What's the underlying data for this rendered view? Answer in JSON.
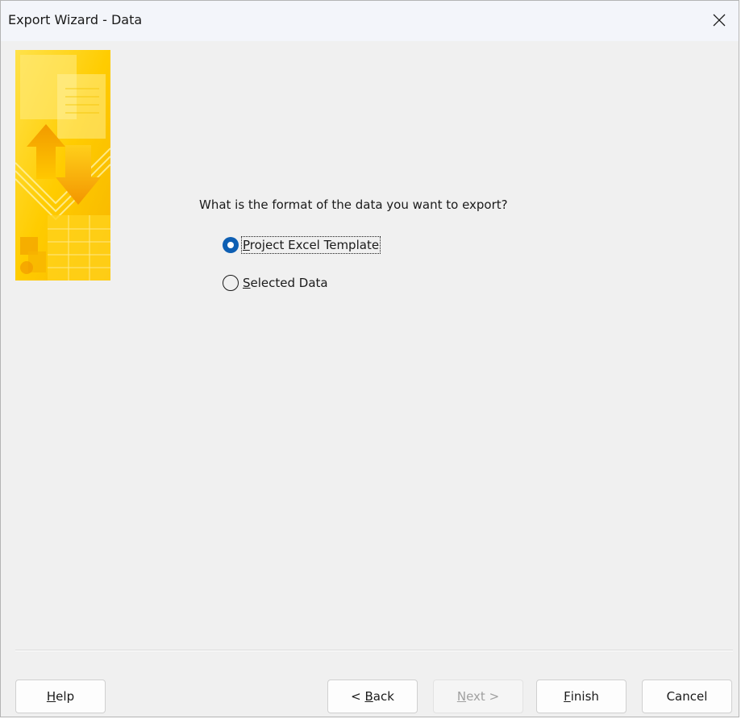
{
  "window": {
    "title": "Export Wizard - Data"
  },
  "banner": {
    "icon": "export-wizard-banner"
  },
  "main": {
    "question": "What is the format of the data you want to export?",
    "options": [
      {
        "mnemonic": "P",
        "rest": "roject Excel Template",
        "selected": true
      },
      {
        "mnemonic": "S",
        "rest": "elected Data",
        "selected": false
      }
    ]
  },
  "buttons": {
    "help": {
      "mnemonic": "H",
      "rest": "elp"
    },
    "back": {
      "prefix": "< ",
      "mnemonic": "B",
      "rest": "ack"
    },
    "next": {
      "mnemonic": "N",
      "rest": "ext >",
      "enabled": false
    },
    "finish": {
      "mnemonic": "F",
      "rest": "inish"
    },
    "cancel": {
      "label": "Cancel"
    }
  },
  "colors": {
    "accent": "#0e5fb3",
    "banner_yellow": "#ffd400",
    "banner_orange": "#f5a800"
  }
}
